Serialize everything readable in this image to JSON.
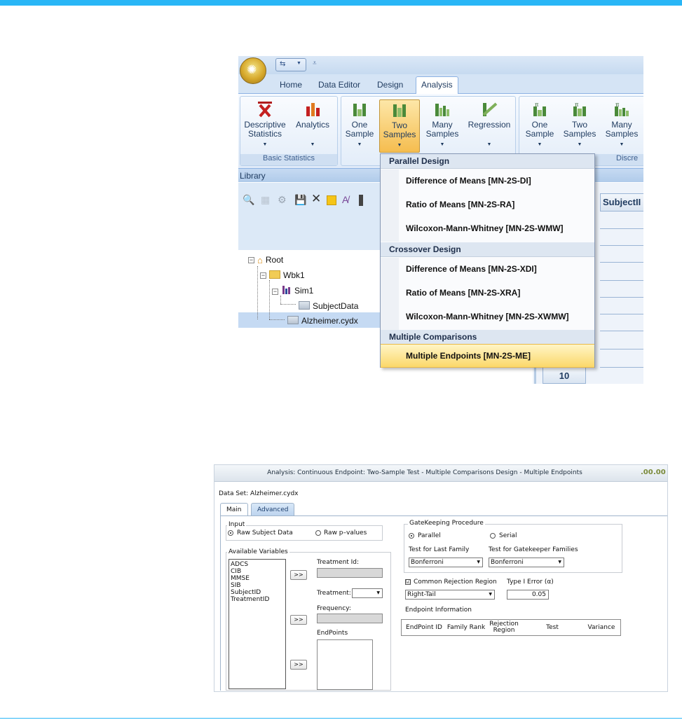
{
  "ribbon": {
    "tabs": [
      "Home",
      "Data Editor",
      "Design",
      "Analysis"
    ],
    "active_tab": "Analysis",
    "groups": {
      "basic_statistics": "Basic Statistics",
      "discrete_partial": "Discre"
    },
    "buttons": {
      "descriptive_line1": "Descriptive",
      "descriptive_line2": "Statistics",
      "analytics": "Analytics",
      "one_sample_line1": "One",
      "one_sample_line2": "Sample",
      "two_samples_line1": "Two",
      "two_samples_line2": "Samples",
      "many_samples_line1": "Many",
      "many_samples_line2": "Samples",
      "regression": "Regression",
      "d_one_line1": "One",
      "d_one_line2": "Sample",
      "d_two_line1": "Two",
      "d_two_line2": "Samples",
      "d_many_line1": "Many",
      "d_many_line2": "Samples"
    }
  },
  "library": {
    "header": "Library",
    "tree": {
      "root": "Root",
      "workbook": "Wbk1",
      "simulation": "Sim1",
      "subject_data": "SubjectData",
      "dataset": "Alzheimer.cydx"
    }
  },
  "grid": {
    "column_header": "SubjectII",
    "row_label": "10"
  },
  "menu": {
    "sections": [
      {
        "header": "Parallel Design",
        "items": [
          "Difference of Means [MN-2S-DI]",
          "Ratio of Means [MN-2S-RA]",
          "Wilcoxon-Mann-Whitney [MN-2S-WMW]"
        ]
      },
      {
        "header": "Crossover Design",
        "items": [
          "Difference of Means [MN-2S-XDI]",
          "Ratio of Means [MN-2S-XRA]",
          "Wilcoxon-Mann-Whitney [MN-2S-XWMW]"
        ]
      },
      {
        "header": "Multiple Comparisons",
        "items": [
          "Multiple Endpoints [MN-2S-ME]"
        ]
      }
    ]
  },
  "dialog": {
    "title": "Analysis: Continuous Endpoint: Two-Sample Test - Multiple Comparisons Design - Multiple Endpoints",
    "dataset_label": "Data Set: Alzheimer.cydx",
    "tabs": [
      "Main",
      "Advanced"
    ],
    "input": {
      "legend": "Input",
      "option_raw_subject": "Raw Subject Data",
      "option_raw_pvalues": "Raw p–values"
    },
    "available_variables": {
      "legend": "Available Variables",
      "items": [
        "ADCS",
        "CIB",
        "MMSE",
        "SIB",
        "SubjectID",
        "TreatmentID"
      ]
    },
    "move_button": ">>",
    "treatment_id_label": "Treatment Id:",
    "treatment_label": "Treatment:",
    "frequency_label": "Frequency:",
    "endpoints_label": "EndPoints",
    "gatekeeping": {
      "legend": "GateKeeping Procedure",
      "option_parallel": "Parallel",
      "option_serial": "Serial",
      "test_last_family_label": "Test for Last Family",
      "test_last_family_value": "Bonferroni",
      "test_gatekeeper_label": "Test for Gatekeeper Families",
      "test_gatekeeper_value": "Bonferroni"
    },
    "common_rejection": {
      "label": "Common Rejection Region",
      "check_mark": "☑",
      "value": "Right-Tail"
    },
    "type1_error": {
      "label": "Type I Error (α)",
      "value": "0.05"
    },
    "endpoint_info": {
      "label": "Endpoint Information",
      "columns": [
        "EndPoint ID",
        "Family Rank",
        "Rejection Region",
        "Test",
        "Variance"
      ]
    }
  }
}
